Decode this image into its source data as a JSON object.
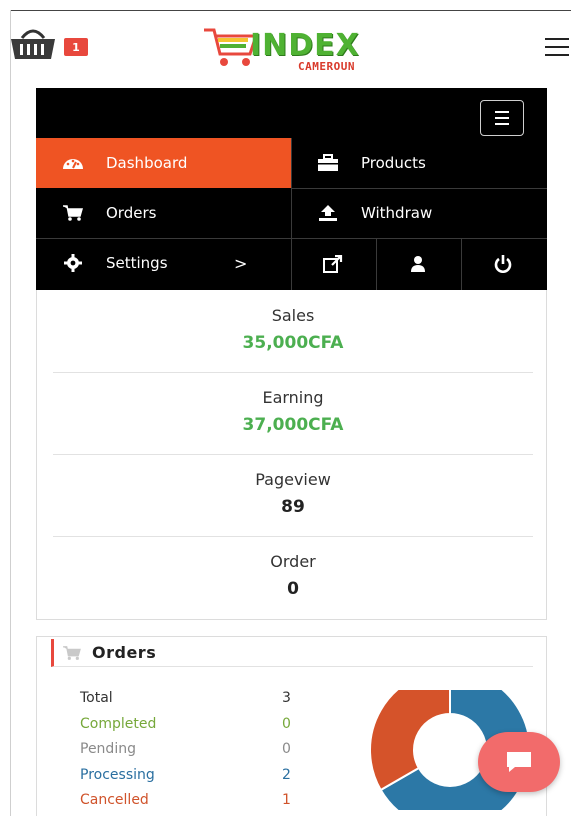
{
  "header": {
    "cart_count": "1",
    "logo_text": "INDEX",
    "logo_sub": "CAMEROUN"
  },
  "menu": {
    "items": [
      {
        "label": "Dashboard",
        "icon": "dashboard-icon",
        "active": true
      },
      {
        "label": "Products",
        "icon": "briefcase-icon",
        "active": false
      },
      {
        "label": "Orders",
        "icon": "cart-icon",
        "active": false
      },
      {
        "label": "Withdraw",
        "icon": "upload-icon",
        "active": false
      },
      {
        "label": "Settings",
        "icon": "gear-icon",
        "active": false
      }
    ],
    "settings_chevron": ">",
    "accent_color": "#ef5423"
  },
  "stats": [
    {
      "label": "Sales",
      "value": "35,000CFA"
    },
    {
      "label": "Earning",
      "value": "37,000CFA"
    },
    {
      "label": "Pageview",
      "value": "89"
    },
    {
      "label": "Order",
      "value": "0"
    }
  ],
  "orders": {
    "title": "Orders",
    "rows": [
      {
        "label": "Total",
        "count": "3",
        "color": "#333333"
      },
      {
        "label": "Completed",
        "count": "0",
        "color": "#76a83a"
      },
      {
        "label": "Pending",
        "count": "0",
        "color": "#8a8a8a"
      },
      {
        "label": "Processing",
        "count": "2",
        "color": "#2a6fa0"
      },
      {
        "label": "Cancelled",
        "count": "1",
        "color": "#d0532b"
      }
    ],
    "chart_colors": {
      "processing": "#2c78a6",
      "cancelled": "#d5532a"
    }
  }
}
